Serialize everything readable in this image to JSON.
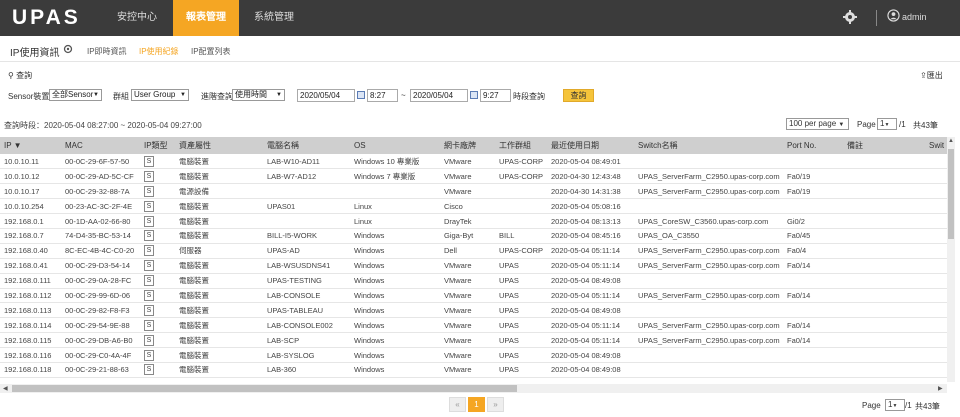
{
  "topbar": {
    "logo": "UPAS",
    "nav": [
      "安控中心",
      "報表管理",
      "系統管理"
    ],
    "user": "admin"
  },
  "subheader": {
    "title": "IP使用資訊",
    "tabs": [
      "IP即時資訊",
      "IP使用紀錄",
      "IP配置列表"
    ]
  },
  "query": {
    "label": "查詢",
    "export": "匯出",
    "sensor_label": "Sensor裝置",
    "sensor_value": "全部Sensor",
    "group_label": "群組",
    "group_value": "User Group",
    "adv_label": "進階查詢",
    "adv_value": "使用時間",
    "start_date": "2020/05/04",
    "start_time": "8:27",
    "dash": "~",
    "end_date": "2020/05/04",
    "end_time": "9:27",
    "range_label": "時段查詢",
    "button": "查詢"
  },
  "period_text": "查詢時段：2020-05-04 08:27:00 ~ 2020-05-04 09:27:00",
  "paging": {
    "per_page": "100 per page",
    "page_label": "Page",
    "page": "1",
    "total_pages": "/1",
    "total": "共43筆"
  },
  "table": {
    "headers": [
      "IP",
      "MAC",
      "IP類型",
      "資產屬性",
      "電腦名稱",
      "OS",
      "網卡廠牌",
      "工作群組",
      "最近使用日期",
      "Switch名稱",
      "Port No.",
      "備註",
      "Swit"
    ],
    "rows": [
      [
        "10.0.10.11",
        "00-0C-29-6F-57-50",
        "S",
        "電腦裝置",
        "LAB-W10-AD11",
        "Windows 10 專業版",
        "VMware",
        "UPAS-CORP",
        "2020-05-04 08:49:01",
        "",
        "",
        "",
        ""
      ],
      [
        "10.0.10.12",
        "00-0C-29-AD-5C-CF",
        "S",
        "電腦裝置",
        "LAB-W7-AD12",
        "Windows 7 專業版",
        "VMware",
        "UPAS-CORP",
        "2020-04-30 12:43:48",
        "UPAS_ServerFarm_C2950.upas-corp.com",
        "Fa0/19",
        "",
        ""
      ],
      [
        "10.0.10.17",
        "00-0C-29-32-88-7A",
        "S",
        "電源設備",
        "",
        "",
        "VMware",
        "",
        "2020-04-30 14:31:38",
        "UPAS_ServerFarm_C2950.upas-corp.com",
        "Fa0/19",
        "",
        ""
      ],
      [
        "10.0.10.254",
        "00-23-AC-3C-2F-4E",
        "S",
        "電腦裝置",
        "UPAS01",
        "Linux",
        "Cisco",
        "",
        "2020-05-04 05:08:16",
        "",
        "",
        "",
        ""
      ],
      [
        "192.168.0.1",
        "00-1D-AA-02-66-80",
        "S",
        "電腦裝置",
        "",
        "Linux",
        "DrayTek",
        "",
        "2020-05-04 08:13:13",
        "UPAS_CoreSW_C3560.upas-corp.com",
        "Gi0/2",
        "",
        ""
      ],
      [
        "192.168.0.7",
        "74-D4-35-BC-53-14",
        "S",
        "電腦裝置",
        "BILL-I5-WORK",
        "Windows",
        "Giga-Byt",
        "BILL",
        "2020-05-04 08:45:16",
        "UPAS_OA_C3550",
        "Fa0/45",
        "",
        ""
      ],
      [
        "192.168.0.40",
        "8C-EC-4B-4C-C0-20",
        "S",
        "伺服器",
        "UPAS-AD",
        "Windows",
        "Dell",
        "UPAS-CORP",
        "2020-05-04 05:11:14",
        "UPAS_ServerFarm_C2950.upas-corp.com",
        "Fa0/4",
        "",
        ""
      ],
      [
        "192.168.0.41",
        "00-0C-29-D3-54-14",
        "S",
        "電腦裝置",
        "LAB-WSUSDNS41",
        "Windows",
        "VMware",
        "UPAS",
        "2020-05-04 05:11:14",
        "UPAS_ServerFarm_C2950.upas-corp.com",
        "Fa0/14",
        "",
        ""
      ],
      [
        "192.168.0.111",
        "00-0C-29-0A-28-FC",
        "S",
        "電腦裝置",
        "UPAS-TESTING",
        "Windows",
        "VMware",
        "UPAS",
        "2020-05-04 08:49:08",
        "",
        "",
        "",
        ""
      ],
      [
        "192.168.0.112",
        "00-0C-29-99-6D-06",
        "S",
        "電腦裝置",
        "LAB-CONSOLE",
        "Windows",
        "VMware",
        "UPAS",
        "2020-05-04 05:11:14",
        "UPAS_ServerFarm_C2950.upas-corp.com",
        "Fa0/14",
        "",
        ""
      ],
      [
        "192.168.0.113",
        "00-0C-29-82-F8-F3",
        "S",
        "電腦裝置",
        "UPAS-TABLEAU",
        "Windows",
        "VMware",
        "UPAS",
        "2020-05-04 08:49:08",
        "",
        "",
        "",
        ""
      ],
      [
        "192.168.0.114",
        "00-0C-29-54-9E-88",
        "S",
        "電腦裝置",
        "LAB-CONSOLE002",
        "Windows",
        "VMware",
        "UPAS",
        "2020-05-04 05:11:14",
        "UPAS_ServerFarm_C2950.upas-corp.com",
        "Fa0/14",
        "",
        ""
      ],
      [
        "192.168.0.115",
        "00-0C-29-DB-A6-B0",
        "S",
        "電腦裝置",
        "LAB-SCP",
        "Windows",
        "VMware",
        "UPAS",
        "2020-05-04 05:11:14",
        "UPAS_ServerFarm_C2950.upas-corp.com",
        "Fa0/14",
        "",
        ""
      ],
      [
        "192.168.0.116",
        "00-0C-29-C0-4A-4F",
        "S",
        "電腦裝置",
        "LAB-SYSLOG",
        "Windows",
        "VMware",
        "UPAS",
        "2020-05-04 08:49:08",
        "",
        "",
        "",
        ""
      ],
      [
        "192.168.0.118",
        "00-0C-29-21-88-63",
        "S",
        "電腦裝置",
        "LAB-360",
        "Windows",
        "VMware",
        "UPAS",
        "2020-05-04 08:49:08",
        "",
        "",
        "",
        ""
      ]
    ]
  },
  "pager": {
    "prev": "«",
    "current": "1",
    "next": "»"
  },
  "colors": {
    "topbar": "#3b3b3b",
    "accent": "#f5a623",
    "header": "#cfcfcf"
  }
}
